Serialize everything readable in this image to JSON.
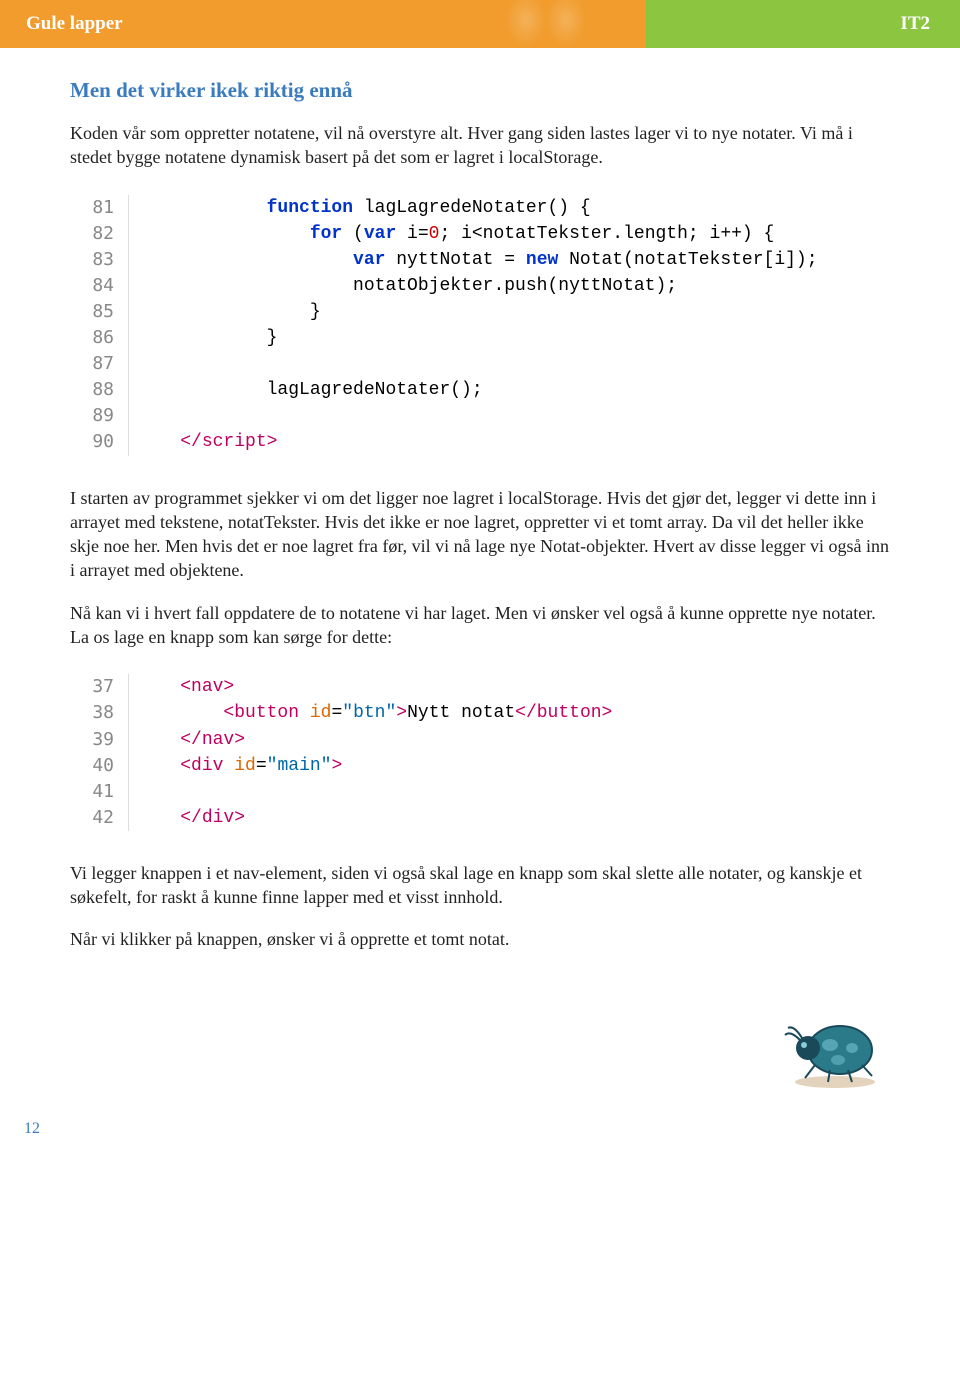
{
  "header": {
    "left": "Gule lapper",
    "right": "IT2"
  },
  "section_title": "Men det virker ikek riktig ennå",
  "p1": "Koden vår som oppretter notatene, vil nå overstyre alt. Hver gang siden lastes lager vi to nye notater. Vi må i stedet bygge notatene dynamisk basert på det som er lagret i localStorage.",
  "p2": "I starten av programmet sjekker vi om det ligger noe lagret i localStorage. Hvis det gjør det, legger vi dette inn i arrayet med tekstene, notatTekster. Hvis det ikke er noe lagret, oppretter vi et tomt array. Da vil det heller ikke skje noe her. Men hvis det er noe lagret fra før, vil vi nå lage nye Notat-objekter. Hvert av disse legger vi også inn i arrayet med objektene.",
  "p3": "Nå kan vi i hvert fall oppdatere de to notatene vi har laget. Men vi ønsker vel også å kunne opprette nye notater. La os lage en knapp som kan sørge for dette:",
  "p4": "Vi legger knappen i et nav-element, siden vi også skal lage en knapp som skal slette alle notater, og kanskje et søkefelt, for raskt å kunne finne lapper med et visst innhold.",
  "p5": "Når vi klikker på knappen, ønsker vi å opprette et tomt notat.",
  "code1": {
    "lines": [
      {
        "n": "81",
        "pre": "            ",
        "cls": "kw",
        "t1": "function",
        "rest": " lagLagredeNotater() {"
      },
      {
        "n": "82",
        "raw": "                <span class='kw'>for</span> (<span class='kw'>var</span> i=<span class='num'>0</span>; i&lt;notatTekster.length; i++) {"
      },
      {
        "n": "83",
        "raw": "                    <span class='kw'>var</span> nyttNotat = <span class='kw'>new</span> Notat(notatTekster[i]);"
      },
      {
        "n": "84",
        "raw": "                    notatObjekter.push(nyttNotat);"
      },
      {
        "n": "85",
        "raw": "                }"
      },
      {
        "n": "86",
        "raw": "            }"
      },
      {
        "n": "87",
        "raw": ""
      },
      {
        "n": "88",
        "raw": "            lagLagredeNotater();"
      },
      {
        "n": "89",
        "raw": ""
      },
      {
        "n": "90",
        "raw": "    <span class='tag'>&lt;/script&gt;</span>"
      }
    ]
  },
  "code2": {
    "lines": [
      {
        "n": "37",
        "raw": "    <span class='tag'>&lt;nav&gt;</span>"
      },
      {
        "n": "38",
        "raw": "        <span class='tag'>&lt;button</span> <span class='attr'>id</span>=<span class='str'>\"btn\"</span><span class='tag'>&gt;</span>Nytt notat<span class='tag'>&lt;/button&gt;</span>"
      },
      {
        "n": "39",
        "raw": "    <span class='tag'>&lt;/nav&gt;</span>"
      },
      {
        "n": "40",
        "raw": "    <span class='tag'>&lt;div</span> <span class='attr'>id</span>=<span class='str'>\"main\"</span><span class='tag'>&gt;</span>"
      },
      {
        "n": "41",
        "raw": ""
      },
      {
        "n": "42",
        "raw": "    <span class='tag'>&lt;/div&gt;</span>"
      }
    ]
  },
  "page_number": "12"
}
